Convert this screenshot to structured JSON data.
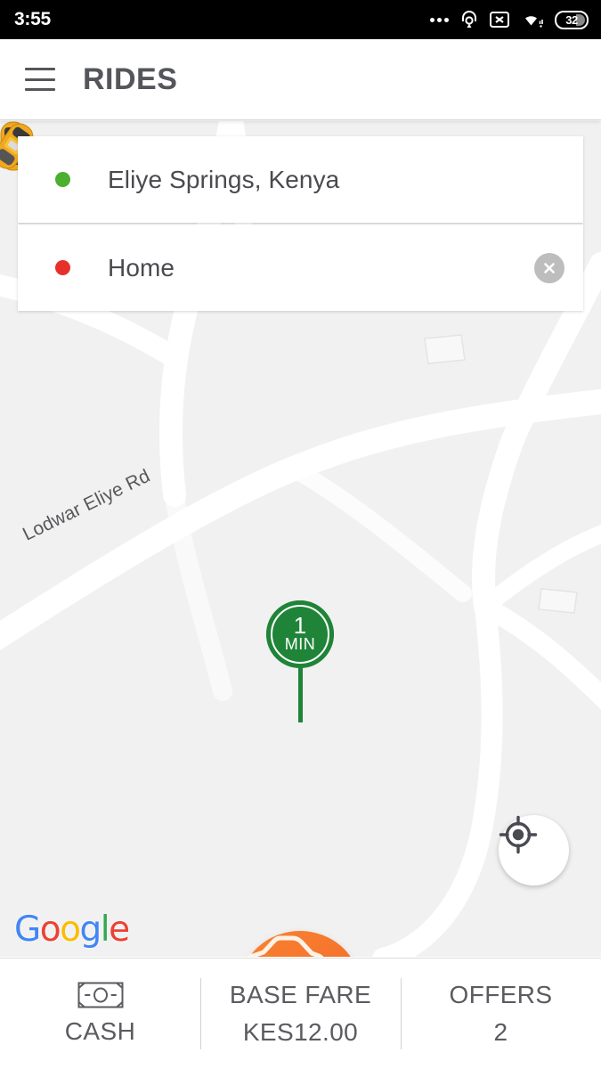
{
  "statusbar": {
    "time": "3:55",
    "icons": [
      "more-dots",
      "headset-icon",
      "no-sim-icon",
      "wifi-icon",
      "battery-icon"
    ],
    "battery_level": "32"
  },
  "appbar": {
    "menu_icon": "hamburger-menu-icon",
    "title": "RIDES"
  },
  "locations": [
    {
      "dot_color": "#4caf30",
      "marker": "pickup-dot",
      "text": "Eliye Springs, Kenya",
      "has_clear": false
    },
    {
      "dot_color": "#e8302a",
      "marker": "destination-dot",
      "text": "Home",
      "has_clear": true,
      "clear_icon": "close-icon"
    }
  ],
  "map": {
    "road_label": "Lodwar Eliye Rd",
    "background_color": "#f1f1f1",
    "road_color": "#ffffff",
    "attribution": {
      "letters": [
        "G",
        "o",
        "o",
        "g",
        "l",
        "e"
      ],
      "colors": [
        "#4285f4",
        "#ea4335",
        "#fbbc05",
        "#4285f4",
        "#34a853",
        "#ea4335"
      ]
    },
    "eta_marker": {
      "value": "1",
      "unit": "MIN",
      "color": "#1f8438"
    },
    "vehicles": [
      {
        "name": "taxi-car-left",
        "heading": "0"
      },
      {
        "name": "taxi-car-center",
        "heading": "35"
      }
    ],
    "my_location_button": "my-location-icon",
    "ride_button": {
      "icon": "car-icon",
      "color": "#f5712b"
    }
  },
  "bottombar": {
    "items": [
      {
        "icon": "cash-icon",
        "top": "",
        "bottom": "CASH"
      },
      {
        "icon": "",
        "top": "BASE FARE",
        "bottom": "KES12.00"
      },
      {
        "icon": "",
        "top": "OFFERS",
        "bottom": "2"
      }
    ]
  }
}
